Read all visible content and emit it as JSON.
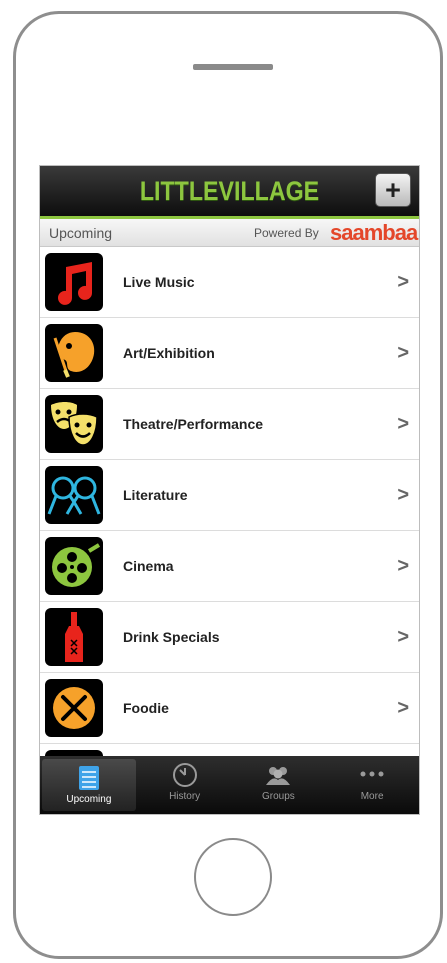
{
  "header": {
    "logo_text": "LITTLEVILLAGE",
    "add_label": "+"
  },
  "subheader": {
    "title": "Upcoming",
    "powered_by": "Powered By",
    "brand": "saambaa"
  },
  "categories": [
    {
      "label": "Live Music",
      "icon": "music-note-icon",
      "color": "#e8241c"
    },
    {
      "label": "Art/Exhibition",
      "icon": "palette-icon",
      "color": "#f6a12a"
    },
    {
      "label": "Theatre/Performance",
      "icon": "theatre-masks-icon",
      "color": "#f4e06a"
    },
    {
      "label": "Literature",
      "icon": "glasses-icon",
      "color": "#2fb6e0"
    },
    {
      "label": "Cinema",
      "icon": "film-reel-icon",
      "color": "#8dc63f"
    },
    {
      "label": "Drink Specials",
      "icon": "bottle-icon",
      "color": "#e8241c"
    },
    {
      "label": "Foodie",
      "icon": "fork-knife-icon",
      "color": "#f6a12a"
    }
  ],
  "chevron": ">",
  "tabs": [
    {
      "label": "Upcoming",
      "icon": "list-icon",
      "active": true
    },
    {
      "label": "History",
      "icon": "clock-icon",
      "active": false
    },
    {
      "label": "Groups",
      "icon": "people-icon",
      "active": false
    },
    {
      "label": "More",
      "icon": "more-dots-icon",
      "active": false
    }
  ],
  "colors": {
    "brand_green": "#8dc63f",
    "brand_red": "#e4472a",
    "tab_active_blue": "#3fa3e8"
  }
}
